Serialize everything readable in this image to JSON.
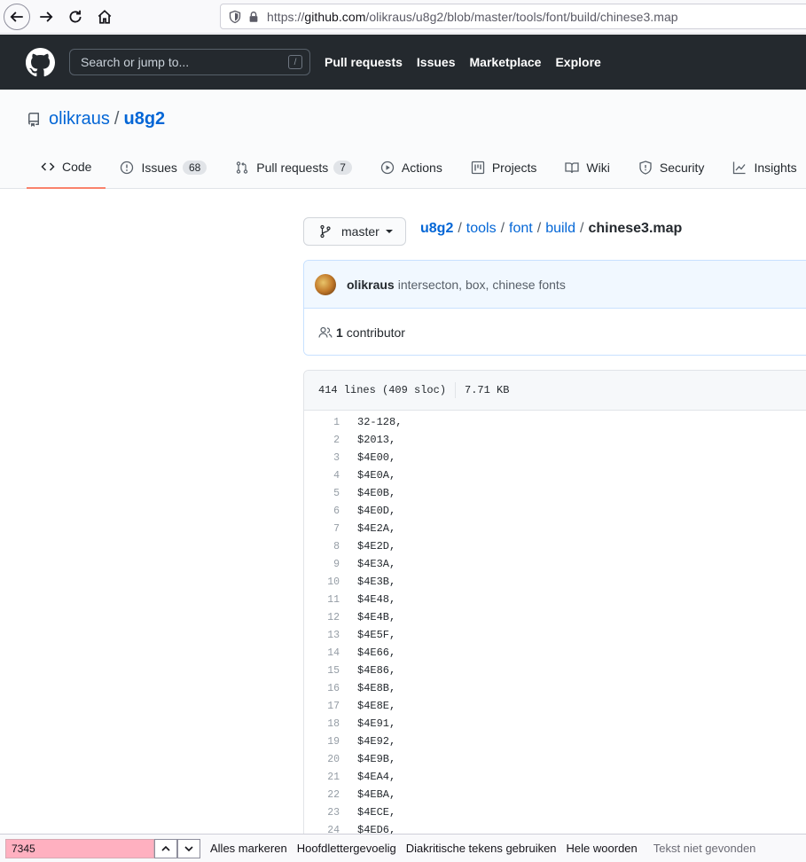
{
  "browser": {
    "url_prefix": "https://",
    "url_host": "github.com",
    "url_path": "/olikraus/u8g2/blob/master/tools/font/build/chinese3.map"
  },
  "gh_header": {
    "search_placeholder": "Search or jump to...",
    "search_key": "/",
    "nav": [
      "Pull requests",
      "Issues",
      "Marketplace",
      "Explore"
    ]
  },
  "repo": {
    "owner": "olikraus",
    "separator": "/",
    "name": "u8g2"
  },
  "tabs": [
    {
      "label": "Code",
      "icon": "code-icon",
      "active": true
    },
    {
      "label": "Issues",
      "icon": "issue-icon",
      "count": "68"
    },
    {
      "label": "Pull requests",
      "icon": "pull-request-icon",
      "count": "7"
    },
    {
      "label": "Actions",
      "icon": "play-icon"
    },
    {
      "label": "Projects",
      "icon": "project-icon"
    },
    {
      "label": "Wiki",
      "icon": "book-icon"
    },
    {
      "label": "Security",
      "icon": "shield-icon"
    },
    {
      "label": "Insights",
      "icon": "graph-icon"
    }
  ],
  "branch": {
    "label": "master"
  },
  "breadcrumb": {
    "root": "u8g2",
    "parts": [
      "tools",
      "font",
      "build"
    ],
    "file": "chinese3.map",
    "sep": "/"
  },
  "commit": {
    "author": "olikraus",
    "message": "intersecton, box, chinese fonts"
  },
  "contributors": {
    "count": "1",
    "label": "contributor"
  },
  "file": {
    "lines_info": "414 lines (409 sloc)",
    "size": "7.71 KB",
    "lines": [
      {
        "n": "1",
        "t": "32-128,"
      },
      {
        "n": "2",
        "t": "$2013,"
      },
      {
        "n": "3",
        "t": "$4E00,"
      },
      {
        "n": "4",
        "t": "$4E0A,"
      },
      {
        "n": "5",
        "t": "$4E0B,"
      },
      {
        "n": "6",
        "t": "$4E0D,"
      },
      {
        "n": "7",
        "t": "$4E2A,"
      },
      {
        "n": "8",
        "t": "$4E2D,"
      },
      {
        "n": "9",
        "t": "$4E3A,"
      },
      {
        "n": "10",
        "t": "$4E3B,"
      },
      {
        "n": "11",
        "t": "$4E48,"
      },
      {
        "n": "12",
        "t": "$4E4B,"
      },
      {
        "n": "13",
        "t": "$4E5F,"
      },
      {
        "n": "14",
        "t": "$4E66,"
      },
      {
        "n": "15",
        "t": "$4E86,"
      },
      {
        "n": "16",
        "t": "$4E8B,"
      },
      {
        "n": "17",
        "t": "$4E8E,"
      },
      {
        "n": "18",
        "t": "$4E91,"
      },
      {
        "n": "19",
        "t": "$4E92,"
      },
      {
        "n": "20",
        "t": "$4E9B,"
      },
      {
        "n": "21",
        "t": "$4EA4,"
      },
      {
        "n": "22",
        "t": "$4EBA,"
      },
      {
        "n": "23",
        "t": "$4ECE,"
      },
      {
        "n": "24",
        "t": "$4ED6,"
      }
    ]
  },
  "findbar": {
    "query": "7345",
    "options": [
      "Alles markeren",
      "Hoofdlettergevoelig",
      "Diakritische tekens gebruiken",
      "Hele woorden"
    ],
    "status": "Tekst niet gevonden"
  },
  "colors": {
    "header_bg": "#24292e",
    "link": "#0366d6",
    "active_tab": "#f9826c",
    "find_not_found": "#ffb0c0"
  }
}
